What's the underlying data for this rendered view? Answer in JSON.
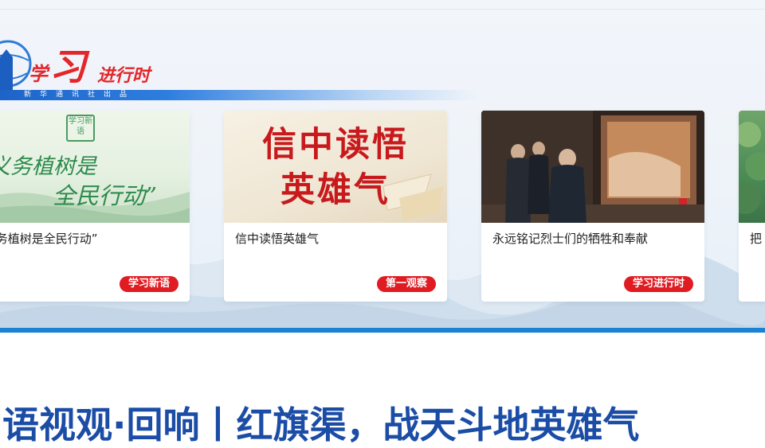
{
  "banner": {
    "logo": {
      "xue": "学",
      "xi": "习",
      "jin": "进行时",
      "publisher": "新华通讯社出品"
    },
    "cards": [
      {
        "title": "“义务植树是全民行动”",
        "tag": "学习新语",
        "image_text": [
          "义务植树是",
          "全民行动”"
        ],
        "seal_text": "学习新语"
      },
      {
        "title": "信中读悟英雄气",
        "tag": "第一观察",
        "image_text": [
          "信中读悟",
          "英雄气"
        ]
      },
      {
        "title": "永远铭记烈士们的牺牲和奉献",
        "tag": "学习进行时"
      },
      {
        "title": "把"
      }
    ]
  },
  "headline": "习语视观·回响丨红旗渠，战天斗地英雄气",
  "colors": {
    "brand_red": "#e01b22",
    "headline_blue": "#1b4da6",
    "band_blue": "#1a82d3"
  }
}
